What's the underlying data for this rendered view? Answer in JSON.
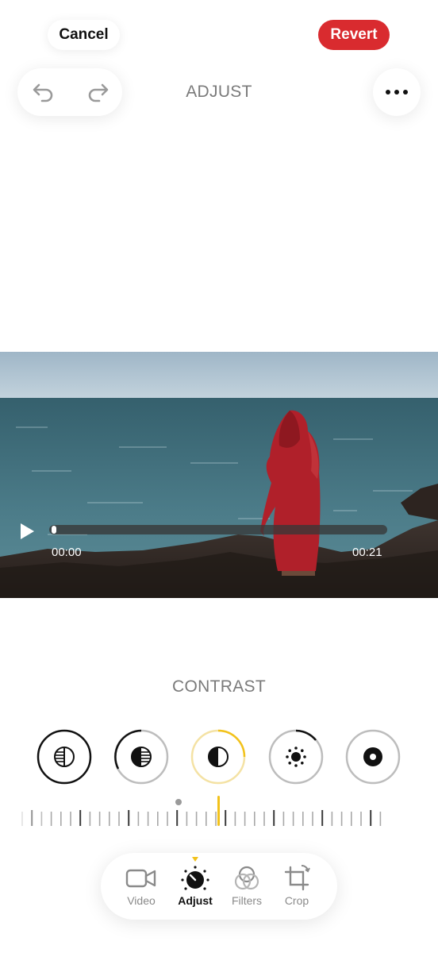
{
  "header": {
    "cancel_label": "Cancel",
    "revert_label": "Revert",
    "title": "ADJUST",
    "accent_color": "#d92b2f"
  },
  "video": {
    "current_time": "00:00",
    "duration": "00:21",
    "progress": 0.0
  },
  "adjust": {
    "selected_tool_label": "CONTRAST",
    "tools": [
      {
        "name": "exposure",
        "selected": false
      },
      {
        "name": "brilliance",
        "selected": false
      },
      {
        "name": "contrast",
        "selected": true
      },
      {
        "name": "brightness",
        "selected": false
      },
      {
        "name": "black-point",
        "selected": false
      }
    ],
    "highlight_color": "#f2c21b"
  },
  "tabs": [
    {
      "label": "Video",
      "icon": "video-camera-icon",
      "active": false
    },
    {
      "label": "Adjust",
      "icon": "adjust-dial-icon",
      "active": true
    },
    {
      "label": "Filters",
      "icon": "filters-icon",
      "active": false
    },
    {
      "label": "Crop",
      "icon": "crop-icon",
      "active": false
    }
  ]
}
